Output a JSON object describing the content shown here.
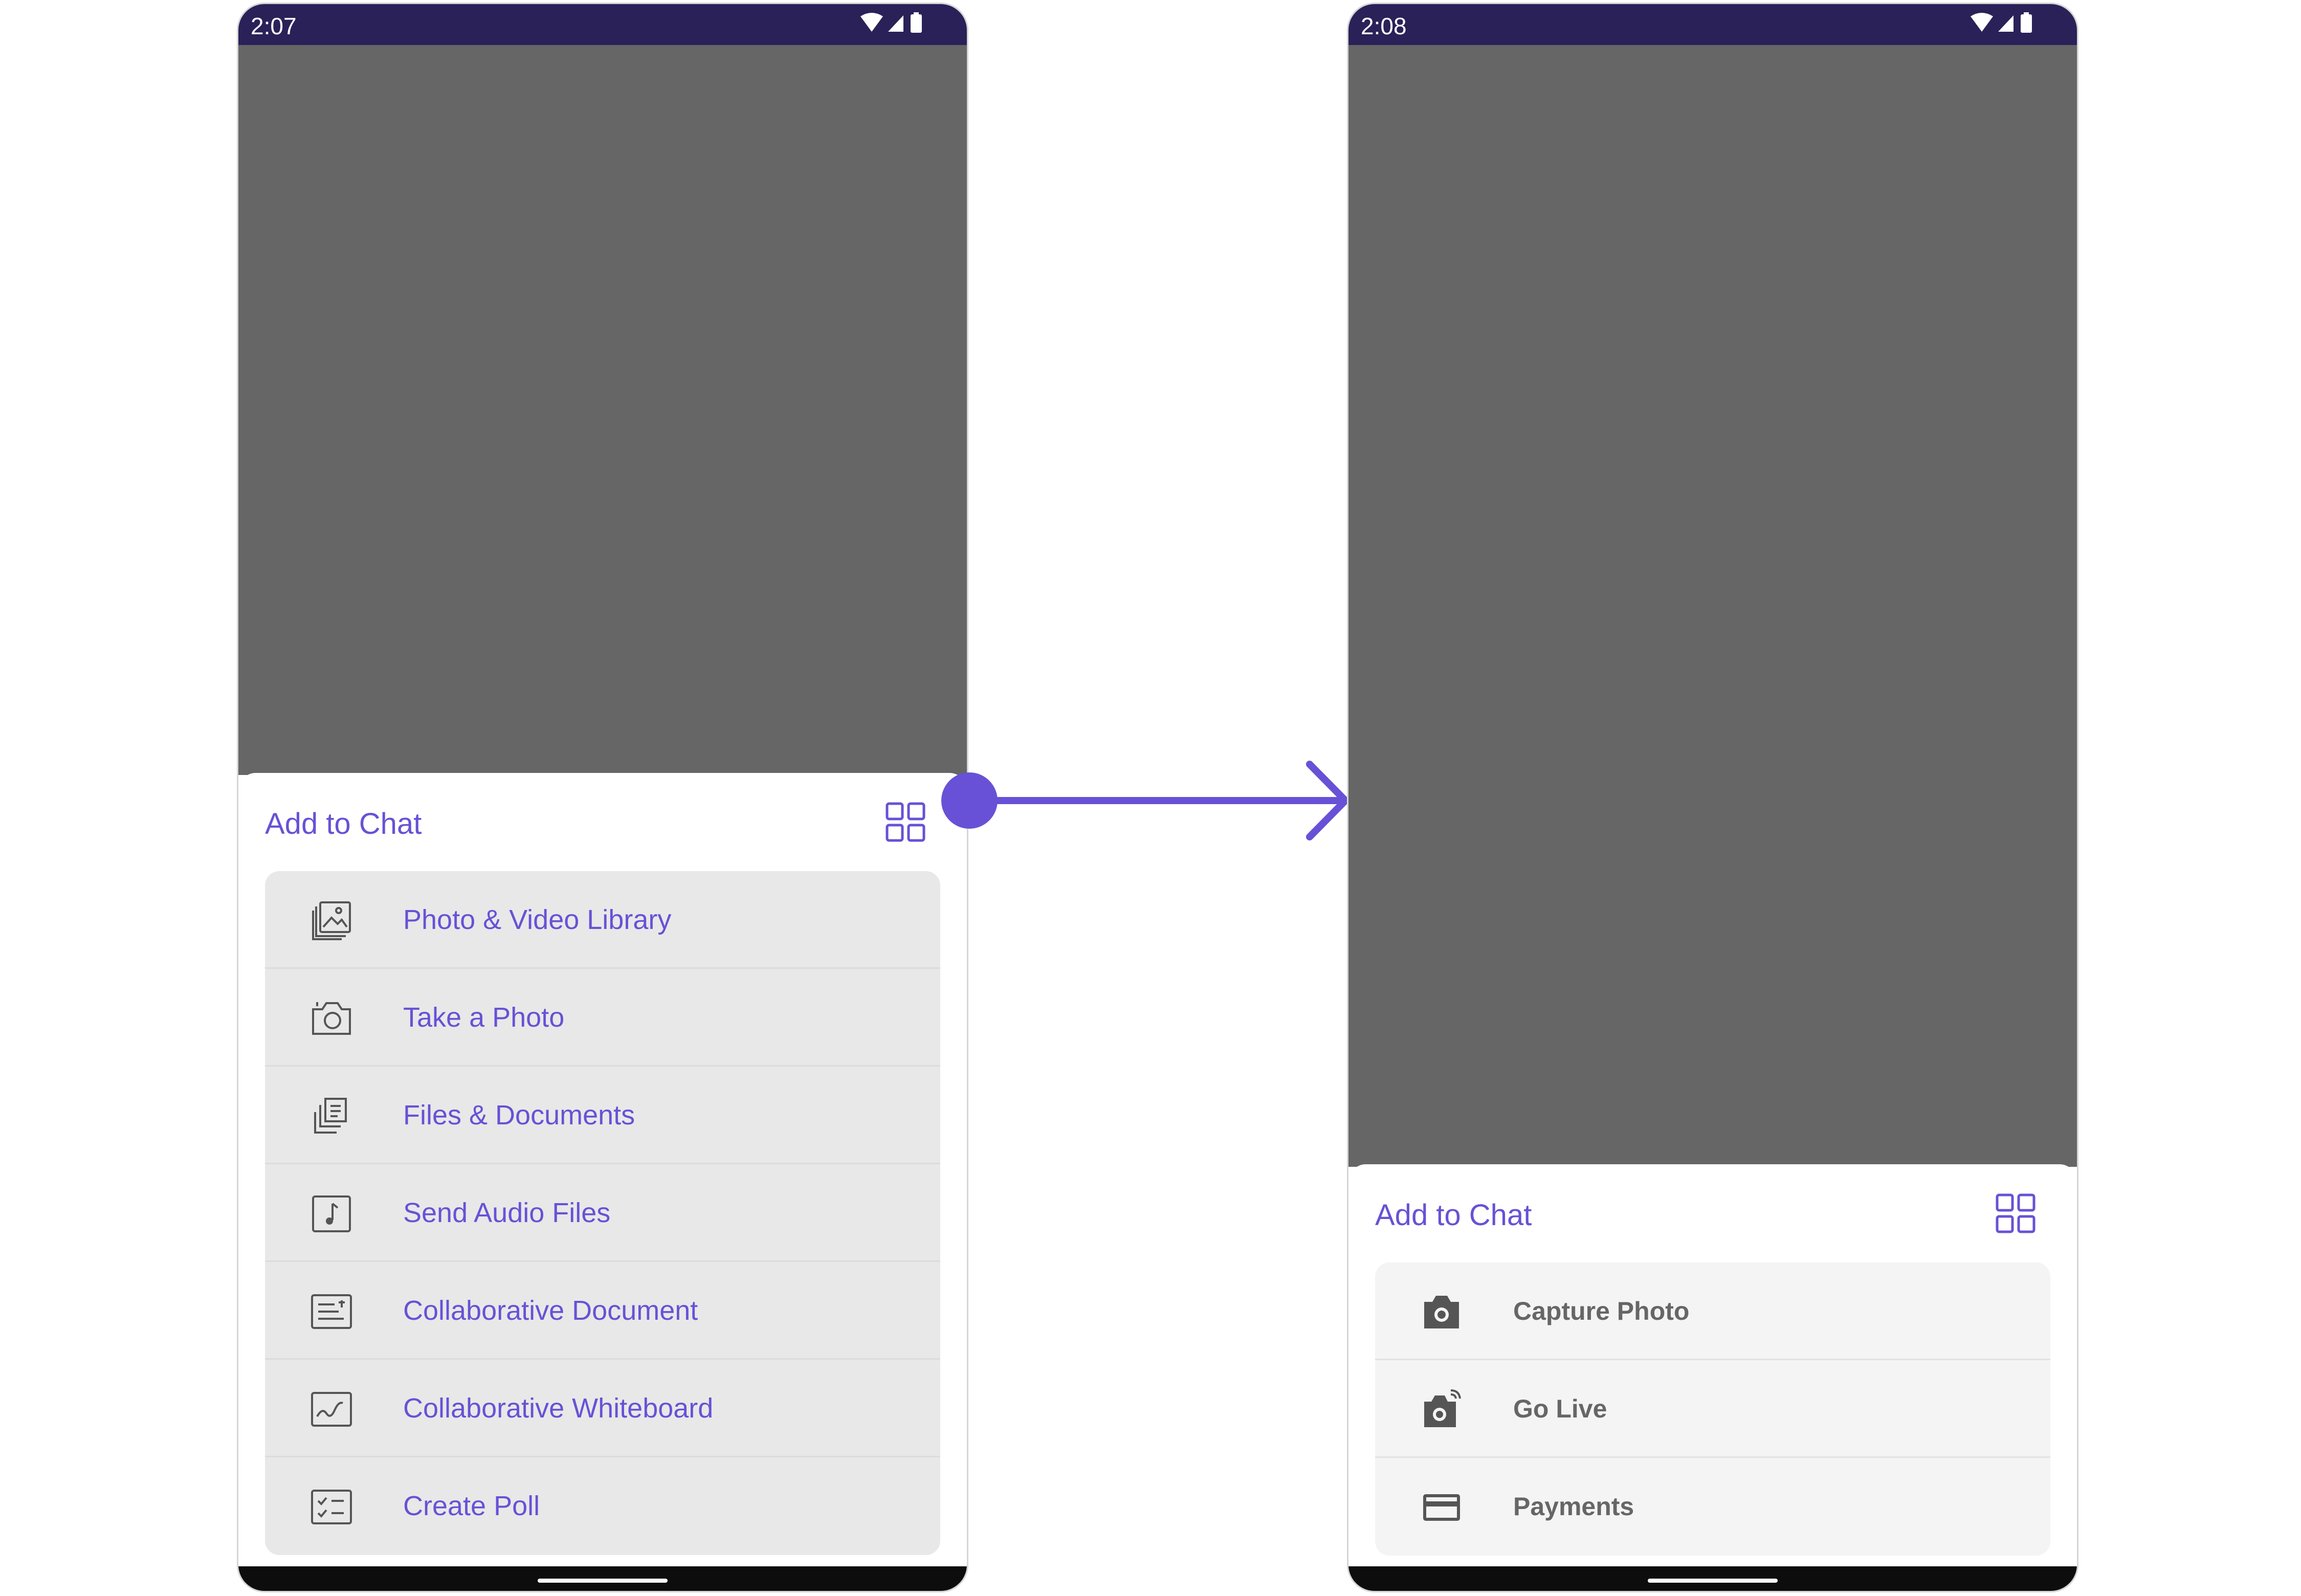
{
  "left_screen": {
    "status_time": "2:07",
    "sheet_title": "Add to Chat",
    "options": [
      {
        "label": "Photo & Video Library",
        "icon": "photo-library-icon"
      },
      {
        "label": "Take a Photo",
        "icon": "camera-icon"
      },
      {
        "label": "Files & Documents",
        "icon": "documents-icon"
      },
      {
        "label": "Send Audio Files",
        "icon": "audio-file-icon"
      },
      {
        "label": "Collaborative Document",
        "icon": "collaborative-document-icon"
      },
      {
        "label": "Collaborative Whiteboard",
        "icon": "whiteboard-icon"
      },
      {
        "label": "Create Poll",
        "icon": "poll-icon"
      }
    ]
  },
  "right_screen": {
    "status_time": "2:08",
    "sheet_title": "Add to Chat",
    "options": [
      {
        "label": "Capture Photo",
        "icon": "camera-filled-icon"
      },
      {
        "label": "Go Live",
        "icon": "live-camera-icon"
      },
      {
        "label": "Payments",
        "icon": "card-icon"
      }
    ]
  },
  "colors": {
    "accent": "#6851d6",
    "status_bar": "#2a2158",
    "overlay": "#666666",
    "left_list_bg": "#e8e8e8",
    "right_list_bg": "#f4f4f4",
    "right_label": "#666666"
  }
}
